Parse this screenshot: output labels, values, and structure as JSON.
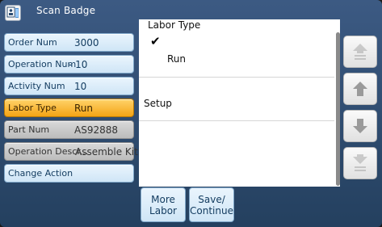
{
  "window": {
    "title": "Scan Badge",
    "icon": "scan-badge-icon"
  },
  "fields": [
    {
      "label": "Order Num",
      "value": "3000",
      "state": "normal"
    },
    {
      "label": "Operation Num",
      "value": "- 10",
      "state": "normal"
    },
    {
      "label": "Activity Num",
      "value": "10",
      "state": "normal"
    },
    {
      "label": "Labor Type",
      "value": "Run",
      "state": "active"
    },
    {
      "label": "Part Num",
      "value": "AS92888",
      "state": "disabled"
    },
    {
      "label": "Operation Descr...",
      "value": "Assemble Kit",
      "state": "disabled"
    },
    {
      "label": "Change Action",
      "value": "",
      "state": "normal"
    }
  ],
  "list": {
    "title": "Labor Type",
    "items": [
      {
        "label": "Run",
        "selected": true
      },
      {
        "label": "Setup",
        "selected": false
      }
    ]
  },
  "nav": {
    "top_icon": "scroll-top-icon",
    "up_icon": "arrow-up-icon",
    "down_icon": "arrow-down-icon",
    "bottom_icon": "scroll-bottom-icon"
  },
  "buttons": {
    "more_labor": "More\nLabor",
    "save_continue": "Save/\nContinue"
  },
  "colors": {
    "active_field": "#f4a415",
    "field_bg": "#cfe5f6",
    "frame": "#2e4b70"
  }
}
